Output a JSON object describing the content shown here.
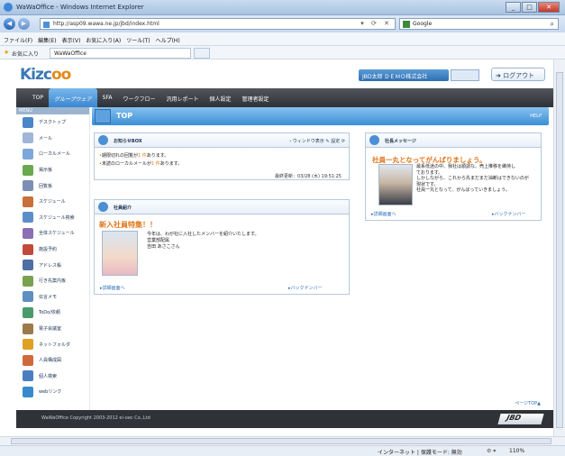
{
  "browser": {
    "title": "WaWaOffice - Windows Internet Explorer",
    "url": "http://asp09.wawa.ne.jp/jbd/index.html",
    "search_value": "Google",
    "menu": [
      "ファイル(F)",
      "編集(E)",
      "表示(V)",
      "お気に入り(A)",
      "ツール(T)",
      "ヘルプ(H)"
    ],
    "favorites_label": "お気に入り",
    "tab_title": "WaWaOffice",
    "status_text": "インターネット | 保護モード: 無効",
    "zoom": "110%"
  },
  "header": {
    "logo": "Kizcoo",
    "logo_main": "Kizc",
    "logo_accent": "oo",
    "user": "JBD太郎 ＤＥＭＯ株式会社",
    "logout_label": "ログアウト"
  },
  "nav": {
    "tabs": [
      "TOP",
      "グループウェア",
      "SFA",
      "ワークフロー",
      "汎用レポート",
      "個人設定",
      "管理者設定"
    ],
    "active_index": 1
  },
  "sidebar": {
    "menu_label": "MENU",
    "items": [
      {
        "label": "デスクトップ",
        "icon": "desktop-icon",
        "color": "#4a86c8"
      },
      {
        "label": "メール",
        "icon": "mail-icon",
        "color": "#9fb6d8"
      },
      {
        "label": "ローカルメール",
        "icon": "local-mail-icon",
        "color": "#7ea7d9"
      },
      {
        "label": "掲示板",
        "icon": "board-icon",
        "color": "#6aa84f"
      },
      {
        "label": "回覧板",
        "icon": "circular-icon",
        "color": "#7b8fb5"
      },
      {
        "label": "スケジュール",
        "icon": "schedule-icon",
        "color": "#c96f3c"
      },
      {
        "label": "スケジュール検索",
        "icon": "schedule-search-icon",
        "color": "#5c8fc8"
      },
      {
        "label": "全体スケジュール",
        "icon": "all-schedule-icon",
        "color": "#8b6fb5"
      },
      {
        "label": "施設予約",
        "icon": "facility-icon",
        "color": "#c14a3a"
      },
      {
        "label": "アドレス帳",
        "icon": "address-book-icon",
        "color": "#4d6fa3"
      },
      {
        "label": "行き先案内板",
        "icon": "destination-icon",
        "color": "#7aa14f"
      },
      {
        "label": "伝言メモ",
        "icon": "memo-icon",
        "color": "#5f8fc0"
      },
      {
        "label": "ToDo/依頼",
        "icon": "todo-icon",
        "color": "#4a9a6a"
      },
      {
        "label": "電子会議室",
        "icon": "meeting-icon",
        "color": "#9c7a4a"
      },
      {
        "label": "ネットフォルダ",
        "icon": "folder-icon",
        "color": "#e0a020"
      },
      {
        "label": "人員構成図",
        "icon": "org-chart-icon",
        "color": "#d06a3a"
      },
      {
        "label": "個人検索",
        "icon": "person-search-icon",
        "color": "#4a7ec0"
      },
      {
        "label": "webリンク",
        "icon": "web-link-icon",
        "color": "#3a8acb"
      }
    ]
  },
  "main": {
    "title": "TOP",
    "help": "HELP",
    "notices": {
      "title": "お知らせBOX",
      "window_toggle": "ウィンドウ表示",
      "settings": "設定",
      "items": [
        {
          "prefix": "期限切れの回覧が",
          "count": "1 件",
          "suffix": "あります。"
        },
        {
          "prefix": "未読のローカルメールが",
          "count": "1 件",
          "suffix": "あります。"
        }
      ],
      "updated": "最終更新：03/28 (水) 19:51:25"
    },
    "employee": {
      "title": "社員紹介",
      "feature": "新入社員特集！！",
      "text": [
        "今年は、わが社に入社したメンバーを紹介いたします。",
        "営業部配属",
        "吉田 あさこさん"
      ],
      "detail_link": "詳細画面へ",
      "backnumber": "バックナンバー"
    },
    "president": {
      "title": "社長メッセージ",
      "headline": "社員一丸となってがんばりましょう。",
      "text": [
        "最系低迷の中、我社は順調な、売上推移を維持し",
        "ております。",
        "しかしながら、これから先まだまだ油断はできないのが",
        "現状です。",
        "社員一丸となって、がんばっていきましょう。"
      ],
      "detail_link": "詳細画面へ",
      "backnumber": "バックナンバー"
    }
  },
  "pagetop": "ページTOP▲",
  "footer": {
    "copyright": "WaWaOffice Copyright 2003-2012 ei-oec Co.,Ltd",
    "brand": "JBD"
  }
}
